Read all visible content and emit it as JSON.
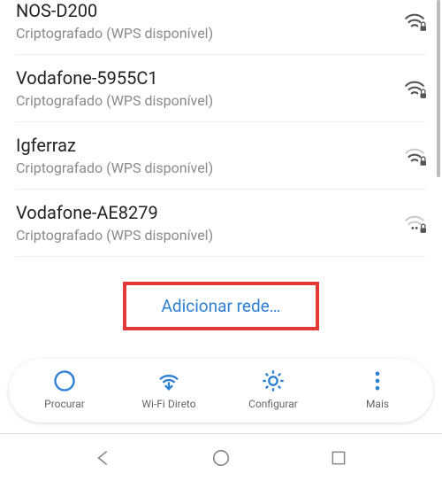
{
  "networks": [
    {
      "ssid": "NOS-D200",
      "sub": "Criptografado (WPS disponível)",
      "strength": 3,
      "locked": true
    },
    {
      "ssid": "Vodafone-5955C1",
      "sub": "Criptografado (WPS disponível)",
      "strength": 3,
      "locked": true
    },
    {
      "ssid": "Igferraz",
      "sub": "Criptografado (WPS disponível)",
      "strength": 2,
      "locked": true
    },
    {
      "ssid": "Vodafone-AE8279",
      "sub": "Criptografado (WPS disponível)",
      "strength": 1,
      "locked": true
    }
  ],
  "add_network_label": "Adicionar rede…",
  "bottom": {
    "scan": "Procurar",
    "direct": "Wi-Fi Direto",
    "configure": "Configurar",
    "more": "Mais"
  },
  "colors": {
    "accent": "#2d7fd3",
    "highlight_border": "#e53935",
    "icon_gray": "#6b6b6b"
  }
}
